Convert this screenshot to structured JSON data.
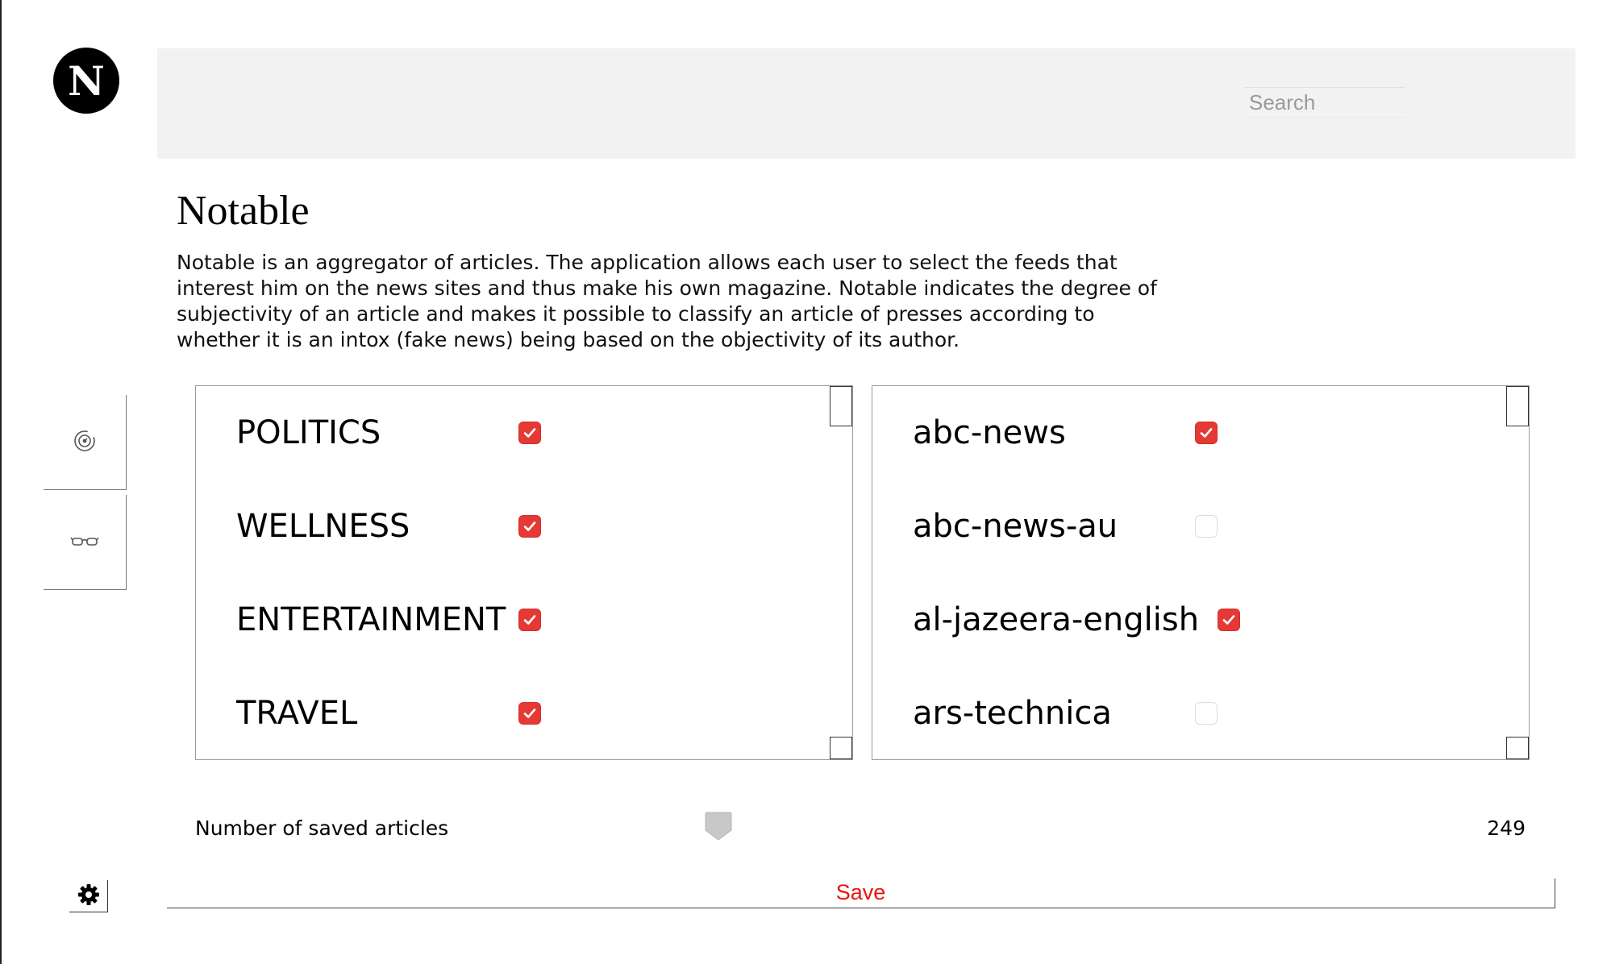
{
  "app": {
    "logo_letter": "N",
    "title": "Notable",
    "description": "Notable is an aggregator of articles. The application allows each user to select the feeds that interest him on the news sites and thus make his own magazine. Notable indicates the degree of subjectivity of an article and makes it possible to classify an article of presses according to whether it is an intox (fake news) being based on the objectivity of its author."
  },
  "header": {
    "search_placeholder": "Search"
  },
  "sidebar": {
    "items": [
      {
        "icon": "eye-target-icon"
      },
      {
        "icon": "glasses-icon"
      }
    ]
  },
  "categories": [
    {
      "label": "POLITICS",
      "checked": true
    },
    {
      "label": "WELLNESS",
      "checked": true
    },
    {
      "label": "ENTERTAINMENT",
      "checked": true
    },
    {
      "label": "TRAVEL",
      "checked": true
    }
  ],
  "sources": [
    {
      "label": "abc-news",
      "checked": true
    },
    {
      "label": "abc-news-au",
      "checked": false
    },
    {
      "label": "al-jazeera-english",
      "checked": true
    },
    {
      "label": "ars-technica",
      "checked": false
    }
  ],
  "saved_articles": {
    "label": "Number of saved articles",
    "value": "249"
  },
  "footer": {
    "save_label": "Save",
    "settings_icon": "gear-icon"
  },
  "colors": {
    "accent": "#e53935",
    "save_text": "#e8160c",
    "header_bg": "#f2f2f3"
  }
}
